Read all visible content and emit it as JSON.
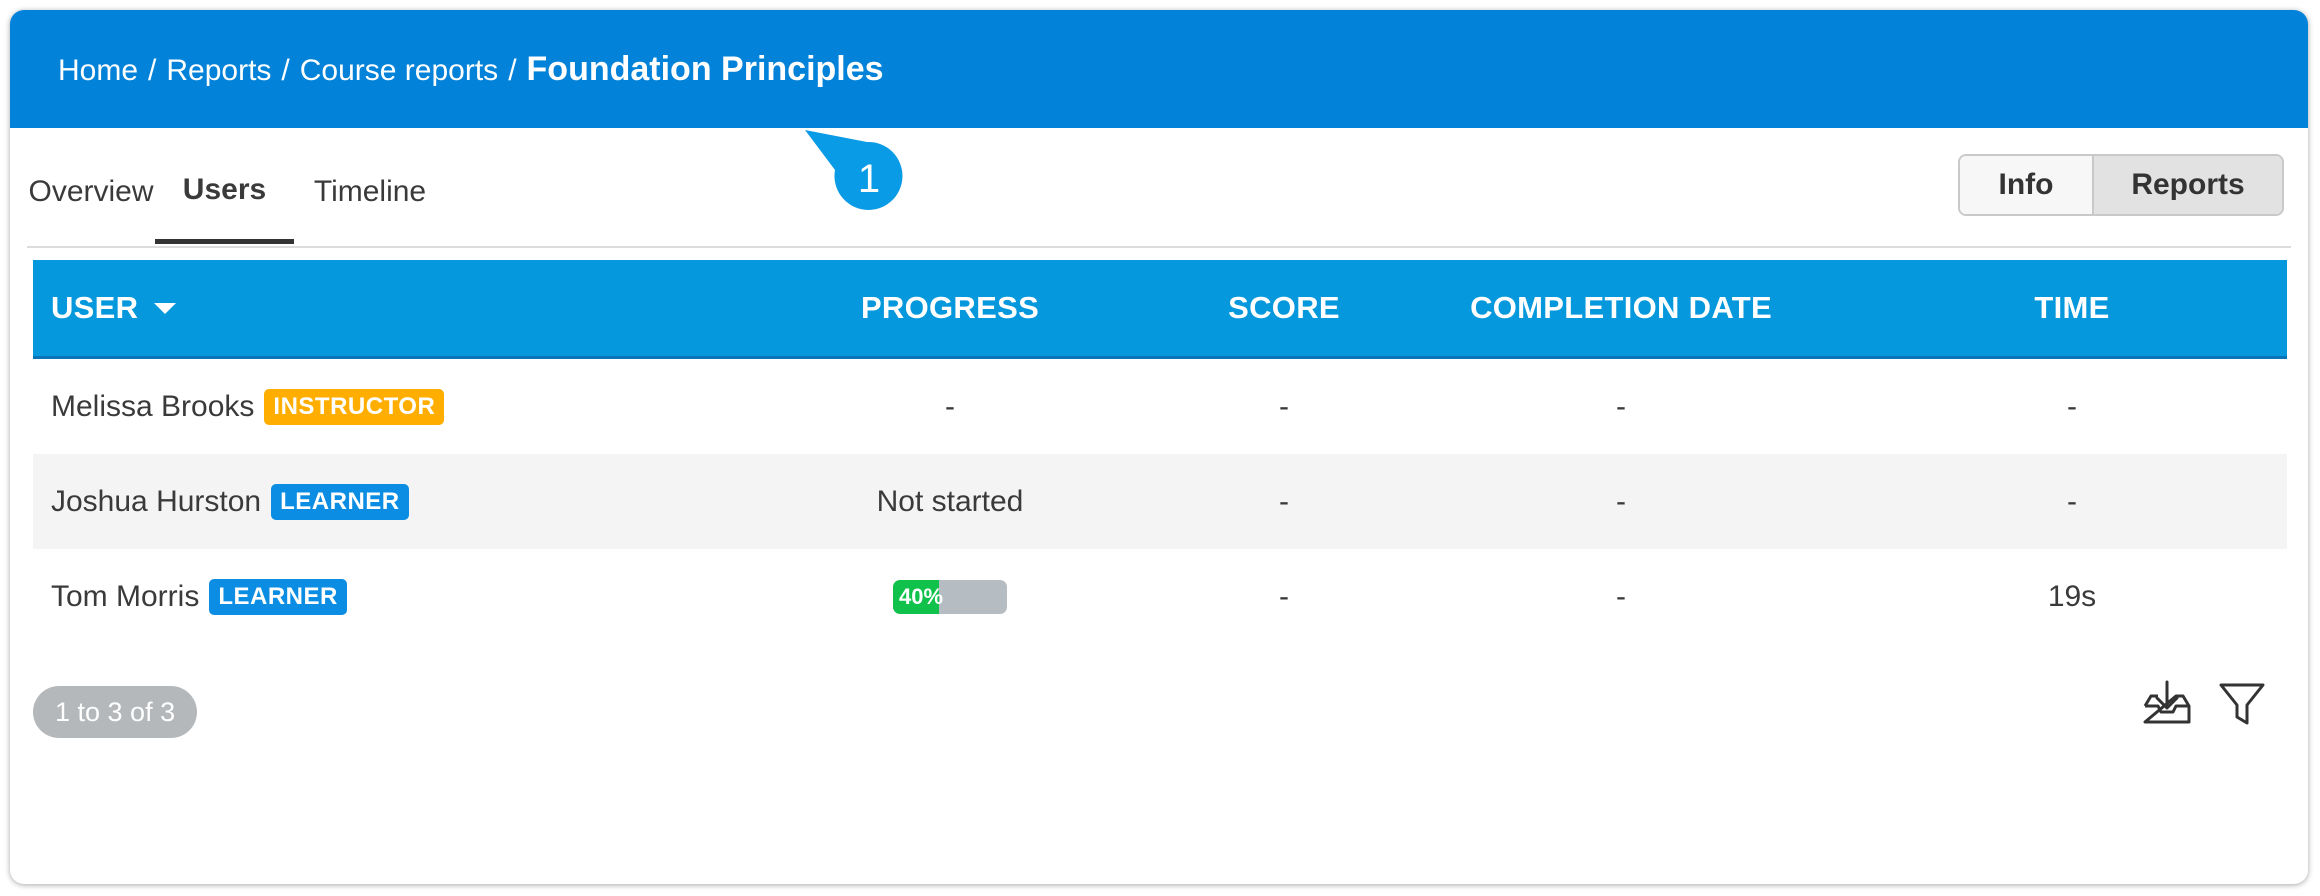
{
  "breadcrumb": {
    "items": [
      "Home",
      "Reports",
      "Course reports"
    ],
    "separator": "/",
    "current": "Foundation Principles"
  },
  "callout": {
    "number": "1",
    "color": "#0a9be6"
  },
  "tabs": [
    {
      "label": "Overview",
      "active": false
    },
    {
      "label": "Users",
      "active": true
    },
    {
      "label": "Timeline",
      "active": false
    }
  ],
  "view_toggle": {
    "info_label": "Info",
    "reports_label": "Reports",
    "selected": "Reports"
  },
  "table": {
    "columns": {
      "user": "USER",
      "progress": "PROGRESS",
      "score": "SCORE",
      "completion_date": "COMPLETION DATE",
      "time": "TIME"
    },
    "sort": {
      "column": "USER",
      "direction": "desc-icon"
    },
    "rows": [
      {
        "name": "Melissa Brooks",
        "role": "INSTRUCTOR",
        "progress": "-",
        "score": "-",
        "completion_date": "-",
        "time": "-"
      },
      {
        "name": "Joshua Hurston",
        "role": "LEARNER",
        "progress": "Not started",
        "score": "-",
        "completion_date": "-",
        "time": "-"
      },
      {
        "name": "Tom Morris",
        "role": "LEARNER",
        "progress_label": "40%",
        "progress_percent": 40,
        "score": "-",
        "completion_date": "-",
        "time": "19s"
      }
    ]
  },
  "pagination": {
    "label": "1 to 3 of 3"
  },
  "tools": {
    "export_icon": "download-tray-icon",
    "filter_icon": "filter-funnel-icon"
  },
  "colors": {
    "header_bg": "#0282d8",
    "table_header_bg": "#0598dc",
    "instructor_badge": "#ffae00",
    "learner_badge": "#0a8de3",
    "progress_fill": "#10c24b",
    "progress_track": "#b5bdc3"
  }
}
